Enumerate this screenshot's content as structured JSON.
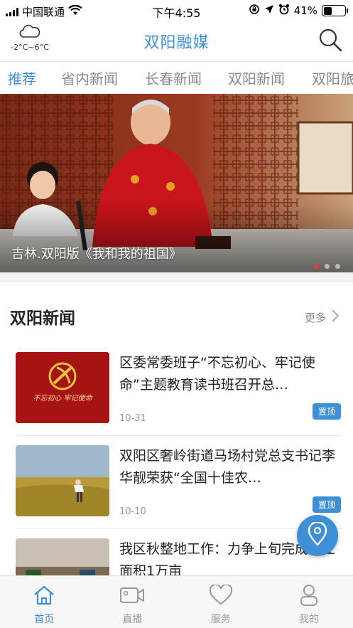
{
  "status_bar": {
    "carrier": "中国联通",
    "time": "下午4:55",
    "battery_text": "41%",
    "battery_level": 0.41
  },
  "header": {
    "weather_icon": "cloud-icon",
    "weather_temp": "-2°C~6°C",
    "title": "双阳融媒",
    "search_icon": "search-icon"
  },
  "tabs": [
    {
      "label": "推荐",
      "active": true
    },
    {
      "label": "省内新闻",
      "active": false
    },
    {
      "label": "长春新闻",
      "active": false
    },
    {
      "label": "双阳新闻",
      "active": false
    },
    {
      "label": "双阳旅",
      "active": false
    }
  ],
  "banner": {
    "caption": "吉林.双阳版《我和我的祖国》",
    "slide_count": 3,
    "active_slide": 1
  },
  "section": {
    "title": "双阳新闻",
    "more_label": "更多"
  },
  "news": [
    {
      "title": "区委常委班子“不忘初心、牢记使命”主题教育读书班召开总…",
      "date": "10-31",
      "badge": "置顶",
      "thumb_text": "不忘初心 牢记使命"
    },
    {
      "title": "双阳区奢岭街道马场村党总支书记李华靓荣获“全国十佳农…",
      "date": "10-10",
      "badge": "置顶"
    },
    {
      "title": "我区秋整地工作：力争上旬完成作业面积1万亩",
      "date": "",
      "badge": ""
    }
  ],
  "bottom_nav": [
    {
      "label": "首页",
      "icon": "home-icon",
      "active": true
    },
    {
      "label": "直播",
      "icon": "video-camera-icon",
      "active": false
    },
    {
      "label": "服务",
      "icon": "heart-icon",
      "active": false
    },
    {
      "label": "我的",
      "icon": "user-icon",
      "active": false
    }
  ],
  "colors": {
    "accent": "#3d8fd6",
    "dot_active": "#e0403a"
  }
}
